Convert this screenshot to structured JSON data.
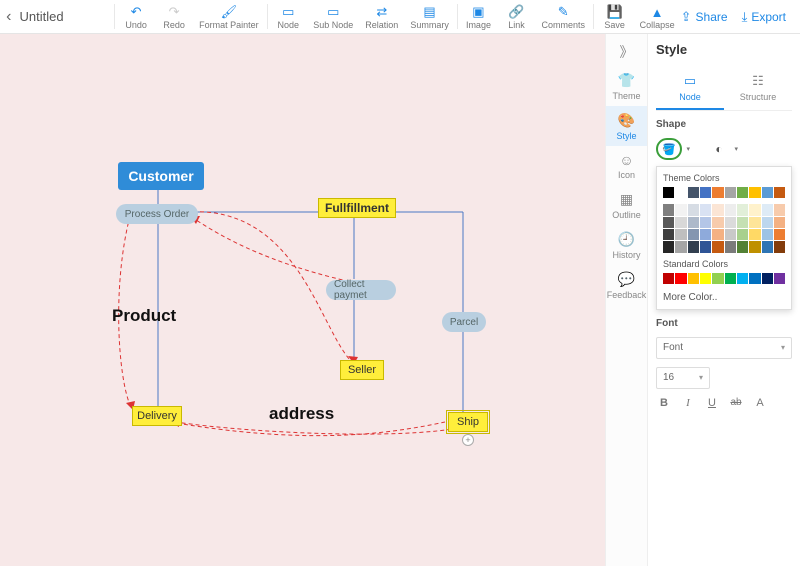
{
  "title": "Untitled",
  "toolbar": {
    "undo": "Undo",
    "redo": "Redo",
    "format_painter": "Format Painter",
    "node": "Node",
    "sub_node": "Sub Node",
    "relation": "Relation",
    "summary": "Summary",
    "image": "Image",
    "link": "Link",
    "comments": "Comments",
    "save": "Save",
    "collapse": "Collapse"
  },
  "actions": {
    "share": "Share",
    "export": "Export"
  },
  "side": {
    "theme": "Theme",
    "style": "Style",
    "icon": "Icon",
    "outline": "Outline",
    "history": "History",
    "feedback": "Feedback"
  },
  "panel": {
    "title": "Style",
    "tab_node": "Node",
    "tab_structure": "Structure",
    "shape_label": "Shape",
    "theme_colors_label": "Theme Colors",
    "standard_colors_label": "Standard Colors",
    "more_color": "More Color..",
    "font_label": "Font",
    "font_family": "Font",
    "font_size": "16",
    "btn_bold": "B",
    "btn_italic": "I",
    "btn_underline": "U",
    "btn_strike": "ab",
    "btn_color": "A"
  },
  "nodes": {
    "customer": "Customer",
    "process_order": "Process Order",
    "fullfillment": "Fullfillment",
    "collect_paymet": "Collect paymet",
    "parcel": "Parcel",
    "seller": "Seller",
    "delivery": "Delivery",
    "ship": "Ship",
    "product": "Product",
    "address": "address"
  },
  "colors": {
    "theme_row0": [
      "#000000",
      "#ffffff",
      "#44546a",
      "#4472c4",
      "#ed7d31",
      "#a5a5a5",
      "#70ad47",
      "#ffc000",
      "#5b9bd5",
      "#c55a11"
    ],
    "theme_shades": [
      [
        "#7f7f7f",
        "#f2f2f2",
        "#d6dce4",
        "#d9e2f3",
        "#fbe5d5",
        "#ededed",
        "#e2efd9",
        "#fff2cc",
        "#deebf6",
        "#f7cbac"
      ],
      [
        "#595959",
        "#d8d8d8",
        "#adb9ca",
        "#b4c6e7",
        "#f7cbac",
        "#dbdbdb",
        "#c5e0b3",
        "#fee599",
        "#bdd7ee",
        "#f4b183"
      ],
      [
        "#3f3f3f",
        "#bfbfbf",
        "#8496b0",
        "#8eaadb",
        "#f4b183",
        "#c9c9c9",
        "#a8d08d",
        "#ffd965",
        "#9cc3e5",
        "#ed7d31"
      ],
      [
        "#262626",
        "#a5a5a5",
        "#323f4f",
        "#2f5496",
        "#c55a11",
        "#7b7b7b",
        "#538135",
        "#bf9000",
        "#2e75b5",
        "#833c0b"
      ]
    ],
    "standard": [
      "#c00000",
      "#ff0000",
      "#ffc000",
      "#ffff00",
      "#92d050",
      "#00b050",
      "#00b0f0",
      "#0070c0",
      "#002060",
      "#7030a0"
    ]
  }
}
